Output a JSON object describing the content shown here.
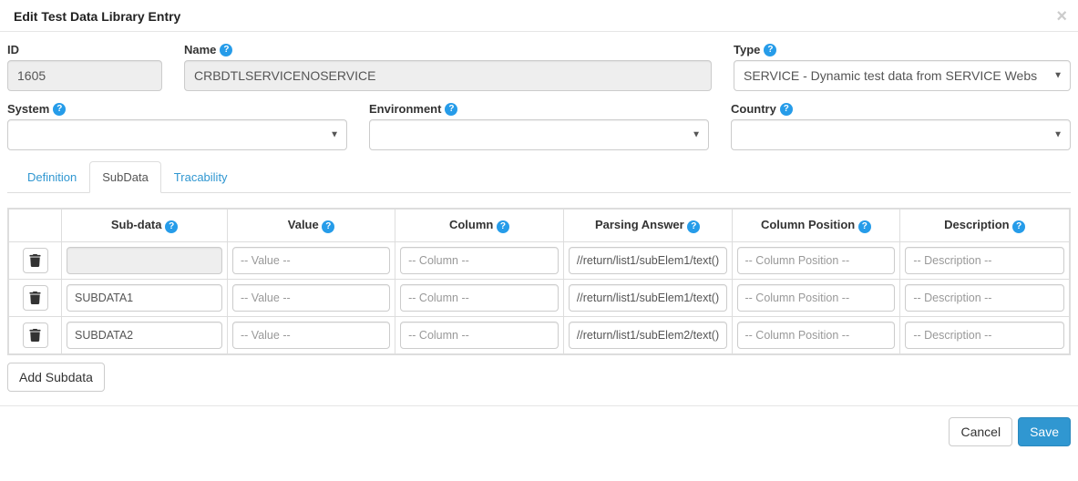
{
  "header": {
    "title": "Edit Test Data Library Entry",
    "close_glyph": "×"
  },
  "form": {
    "id_label": "ID",
    "id_value": "1605",
    "name_label": "Name",
    "name_value": "CRBDTLSERVICENOSERVICE",
    "type_label": "Type",
    "type_value": "SERVICE - Dynamic test data from SERVICE Webs",
    "system_label": "System",
    "system_value": "",
    "environment_label": "Environment",
    "environment_value": "",
    "country_label": "Country",
    "country_value": ""
  },
  "tabs": {
    "definition": "Definition",
    "subdata": "SubData",
    "tracability": "Tracability"
  },
  "table": {
    "headers": {
      "subdata": "Sub-data",
      "value": "Value",
      "column": "Column",
      "parsing": "Parsing Answer",
      "colpos": "Column Position",
      "desc": "Description"
    },
    "placeholders": {
      "value": "-- Value --",
      "column": "-- Column --",
      "colpos": "-- Column Position --",
      "desc": "-- Description --"
    },
    "rows": [
      {
        "subdata": "",
        "subdata_readonly": true,
        "value": "",
        "column": "",
        "parsing": "//return/list1/subElem1/text()",
        "colpos": "",
        "desc": ""
      },
      {
        "subdata": "SUBDATA1",
        "subdata_readonly": false,
        "value": "",
        "column": "",
        "parsing": "//return/list1/subElem1/text()",
        "colpos": "",
        "desc": ""
      },
      {
        "subdata": "SUBDATA2",
        "subdata_readonly": false,
        "value": "",
        "column": "",
        "parsing": "//return/list1/subElem2/text()",
        "colpos": "",
        "desc": ""
      }
    ],
    "add_label": "Add Subdata"
  },
  "footer": {
    "cancel": "Cancel",
    "save": "Save"
  },
  "glyphs": {
    "help": "?"
  }
}
